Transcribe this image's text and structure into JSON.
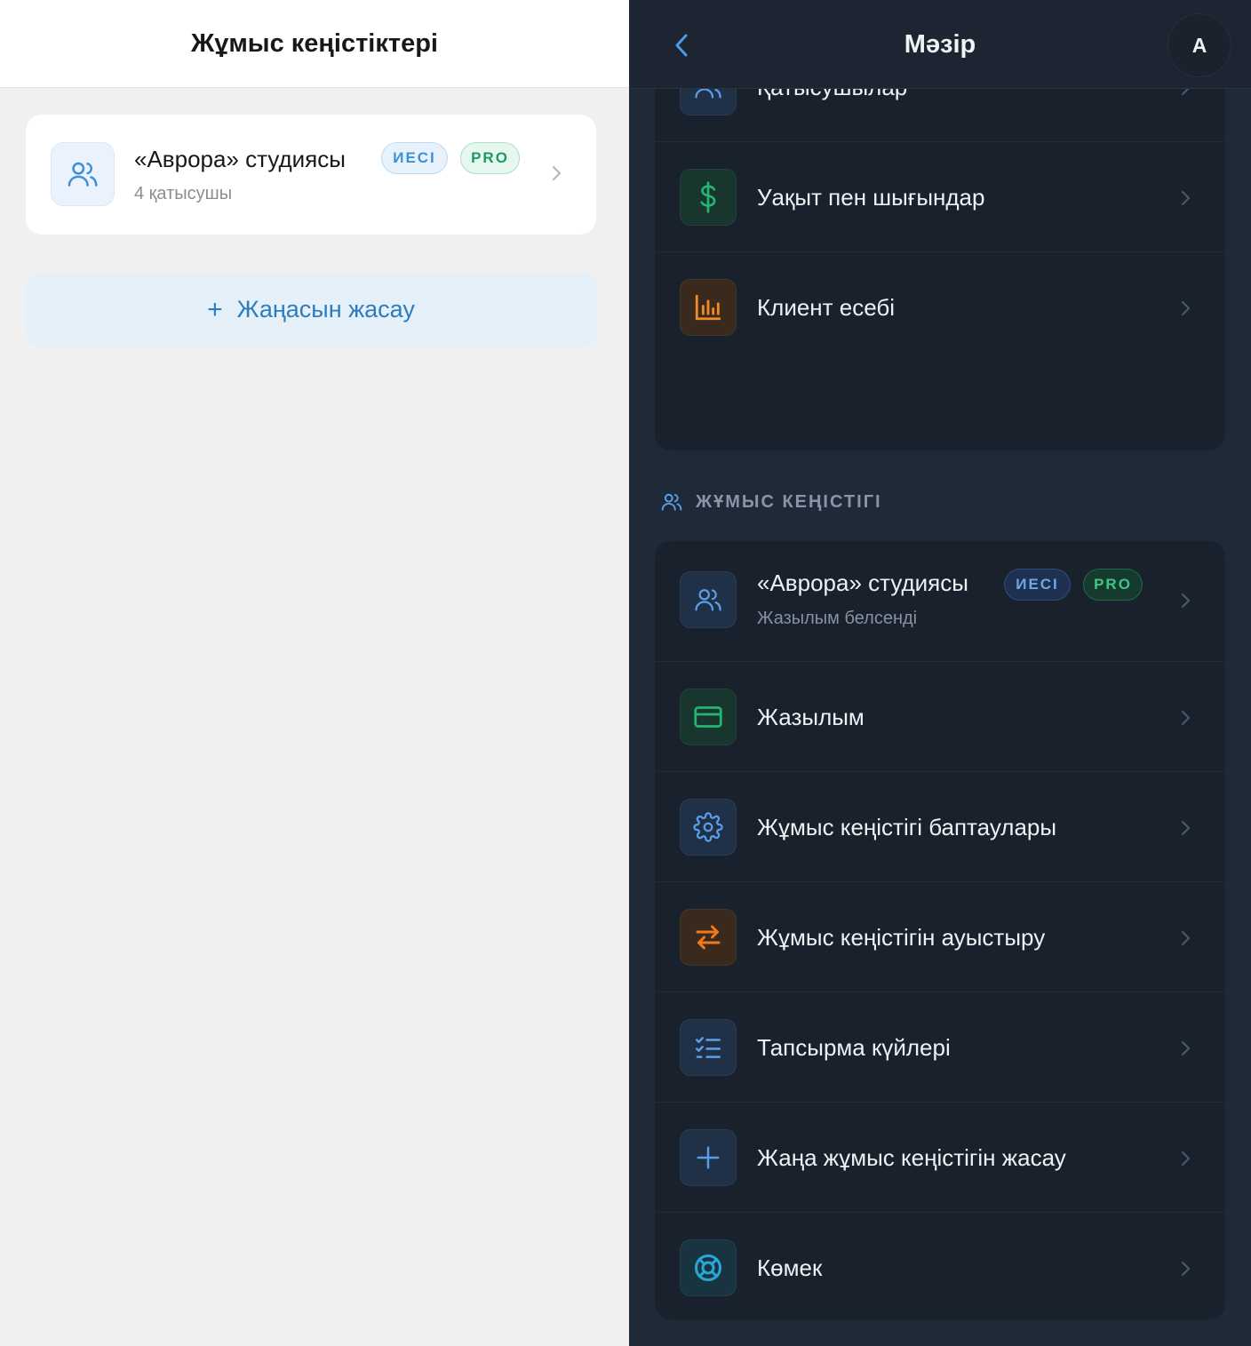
{
  "left": {
    "title": "Жұмыс кеңістіктері",
    "workspace": {
      "name": "«Аврора» студиясы",
      "owner_badge": "ИЕСІ",
      "pro_badge": "PRO",
      "members": "4 қатысушы"
    },
    "create_plus": "+",
    "create_label": "Жаңасын жасау"
  },
  "right": {
    "title": "Мәзір",
    "avatar_letter": "A",
    "top_items": [
      {
        "label": "Қатысушылар",
        "icon": "users-icon"
      },
      {
        "label": "Уақыт пен шығындар",
        "icon": "dollar-icon"
      },
      {
        "label": "Клиент есебі",
        "icon": "bar-chart-icon"
      }
    ],
    "section_title": "ЖҰМЫС КЕҢІСТІГІ",
    "workspace": {
      "name": "«Аврора» студиясы",
      "owner_badge": "ИЕСІ",
      "pro_badge": "PRO",
      "status": "Жазылым белсенді"
    },
    "ws_items": [
      {
        "label": "Жазылым",
        "icon": "credit-card-icon"
      },
      {
        "label": "Жұмыс кеңістігі баптаулары",
        "icon": "gear-icon"
      },
      {
        "label": "Жұмыс кеңістігін ауыстыру",
        "icon": "switch-arrows-icon"
      },
      {
        "label": "Тапсырма күйлері",
        "icon": "checklist-icon"
      },
      {
        "label": "Жаңа жұмыс кеңістігін жасау",
        "icon": "plus-icon"
      },
      {
        "label": "Көмек",
        "icon": "lifebuoy-icon"
      }
    ]
  },
  "colors": {
    "accent_blue": "#3d8fd6",
    "green": "#1c9a62",
    "orange": "#f07a1a",
    "dark_bg": "#1f2a38",
    "card_dark": "#18212c"
  }
}
